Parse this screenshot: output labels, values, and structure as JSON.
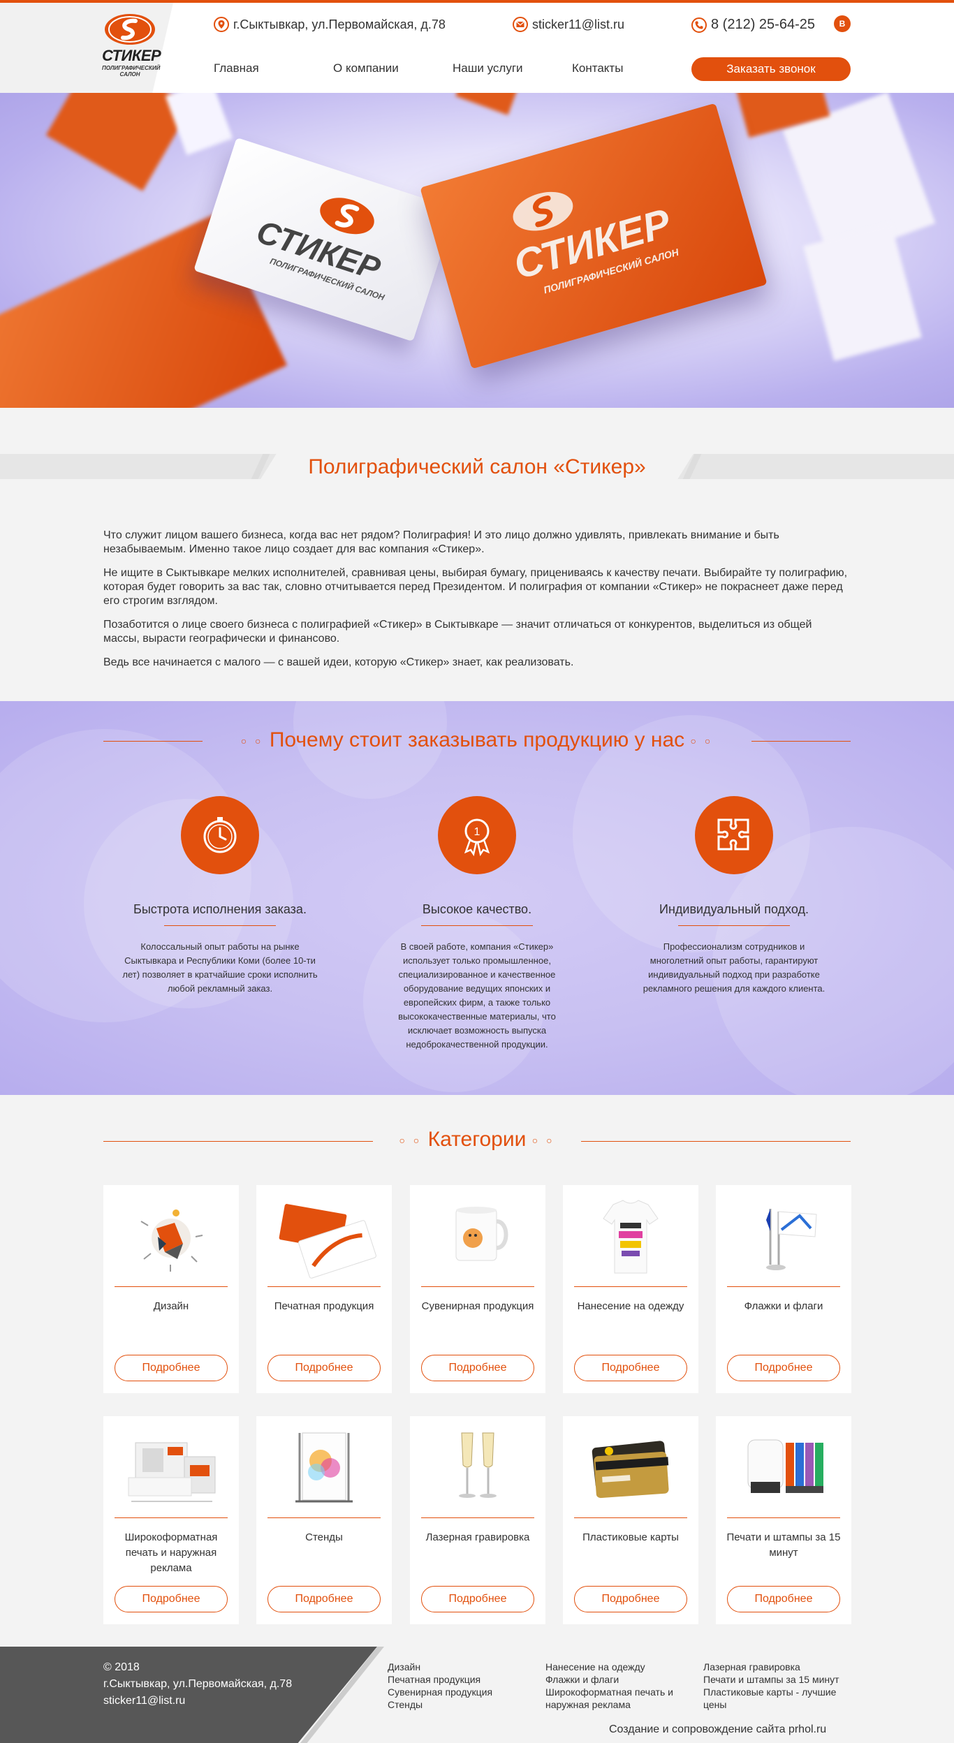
{
  "header": {
    "logo": {
      "name": "СТИКЕР",
      "subtitle_line1": "ПОЛИГРАФИЧЕСКИЙ",
      "subtitle_line2": "САЛОН"
    },
    "address": "г.Сыктывкар, ул.Первомайская, д.78",
    "email": "sticker11@list.ru",
    "phone": "8 (212) 25-64-25",
    "social": "В",
    "nav": [
      "Главная",
      "О компании",
      "Наши услуги",
      "Контакты"
    ],
    "cta_label": "Заказать звонок",
    "accent_color": "#e2500d"
  },
  "hero": {
    "card_brand": "СТИКЕР",
    "card_sub": "ПОЛИГРАФИЧЕСКИЙ САЛОН"
  },
  "about": {
    "title": "Полиграфический салон «Стикер»",
    "paragraphs": [
      "Что служит лицом вашего бизнеса, когда вас нет рядом? Полиграфия! И это лицо должно удивлять, привлекать внимание и быть незабываемым. Именно такое лицо создает для вас компания «Стикер».",
      "Не ищите в Сыктывкаре мелких исполнителей, сравнивая цены, выбирая бумагу, прицениваясь к качеству печати. Выбирайте ту полиграфию, которая будет говорить за вас так, словно отчитывается перед Президентом. И полиграфия от компании «Стикер» не покраснеет даже перед его строгим взглядом.",
      "Позаботится о лице своего бизнеса с полиграфией «Стикер» в Сыктывкаре — значит отличаться от конкурентов, выделиться из общей массы, вырасти географически и финансово.",
      "Ведь все начинается с малого — с вашей идеи, которую «Стикер» знает, как реализовать."
    ]
  },
  "why": {
    "title": "Почему стоит заказывать продукцию у нас",
    "features": [
      {
        "icon": "clock-icon",
        "title": "Быстрота исполнения заказа.",
        "text": "Колоссальный опыт работы на рынке Сыктывкара и Республики Коми (более 10-ти лет) позволяет в кратчайшие сроки исполнить любой рекламный заказ."
      },
      {
        "icon": "award-medal-icon",
        "title": "Высокое качество.",
        "text": "В своей работе, компания «Стикер» использует только промышленное, специализированное и качественное оборудование ведущих японских и европейских фирм, а также только высококачественные материалы, что исключает возможность выпуска недоброкачественной продукции."
      },
      {
        "icon": "puzzle-icon",
        "title": "Индивидуальный подход.",
        "text": "Профессионализм сотрудников и многолетний опыт работы, гарантируют индивидуальный подход при разработке рекламного решения для каждого клиента."
      }
    ]
  },
  "categories": {
    "title": "Категории",
    "button_label": "Подробнее",
    "items": [
      {
        "name": "Дизайн",
        "icon": "design-illustration"
      },
      {
        "name": "Печатная продукция",
        "icon": "business-cards-illustration"
      },
      {
        "name": "Сувенирная продукция",
        "icon": "mug-illustration"
      },
      {
        "name": "Нанесение на одежду",
        "icon": "tshirt-illustration"
      },
      {
        "name": "Флажки и флаги",
        "icon": "flags-illustration"
      },
      {
        "name": "Широкоформатная печать и наружная реклама",
        "icon": "billboard-illustration"
      },
      {
        "name": "Стенды",
        "icon": "stand-illustration"
      },
      {
        "name": "Лазерная гравировка",
        "icon": "glasses-illustration"
      },
      {
        "name": "Пластиковые карты",
        "icon": "plastic-cards-illustration"
      },
      {
        "name": "Печати и штампы за 15 минут",
        "icon": "stamps-illustration"
      }
    ]
  },
  "footer": {
    "copyright": "© 2018",
    "address": "г.Сыктывкар, ул.Первомайская, д.78",
    "email": "sticker11@list.ru",
    "col1": [
      "Дизайн",
      "Печатная продукция",
      "Сувенирная продукция",
      "Стенды"
    ],
    "col2": [
      "Нанесение на одежду",
      "Флажки и флаги",
      "Широкоформатная печать и наружная реклама"
    ],
    "col3": [
      "Лазерная гравировка",
      "Печати и штампы за 15 минут",
      "Пластиковые карты - лучшие цены"
    ],
    "credit": "Создание и сопровождение сайта prhol.ru"
  }
}
